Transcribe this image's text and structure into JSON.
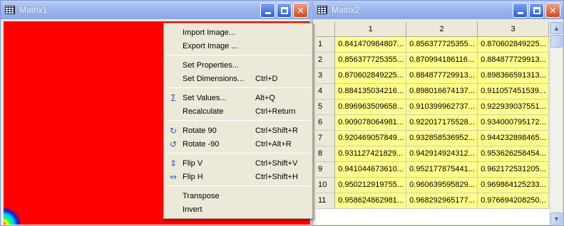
{
  "matrix1": {
    "title": "Matrix1"
  },
  "matrix2": {
    "title": "Matrix2",
    "columns": [
      "1",
      "2",
      "3"
    ],
    "rows": [
      {
        "label": "1",
        "cells": [
          "0.841470984807...",
          "0.856377725355...",
          "0.870602849225..."
        ]
      },
      {
        "label": "2",
        "cells": [
          "0.856377725355...",
          "0.870994186116...",
          "0.884877729913..."
        ]
      },
      {
        "label": "3",
        "cells": [
          "0.870602849225...",
          "0.884877729913...",
          "0.898366591313..."
        ]
      },
      {
        "label": "4",
        "cells": [
          "0.884135034216...",
          "0.898016674137...",
          "0.911057451539..."
        ]
      },
      {
        "label": "5",
        "cells": [
          "0.896963509658...",
          "0.910399962737...",
          "0.922939037551..."
        ]
      },
      {
        "label": "6",
        "cells": [
          "0.909078064981...",
          "0.922017175528...",
          "0.934000795172..."
        ]
      },
      {
        "label": "7",
        "cells": [
          "0.920469057849...",
          "0.932858536952...",
          "0.944232898465..."
        ]
      },
      {
        "label": "8",
        "cells": [
          "0.931127421829...",
          "0.942914924312...",
          "0.953626258454..."
        ]
      },
      {
        "label": "9",
        "cells": [
          "0.941044673610...",
          "0.952177875441...",
          "0.962172531205..."
        ]
      },
      {
        "label": "10",
        "cells": [
          "0.950212919755...",
          "0.960639595829...",
          "0.969864125233..."
        ]
      },
      {
        "label": "11",
        "cells": [
          "0.958624862981...",
          "0.968292965177...",
          "0.976694208250..."
        ]
      }
    ]
  },
  "menu": {
    "items": [
      {
        "label": "Import Image...",
        "shortcut": "",
        "icon": ""
      },
      {
        "label": "Export Image ...",
        "shortcut": "",
        "icon": ""
      },
      {
        "sep": true
      },
      {
        "label": "Set Properties...",
        "shortcut": "",
        "icon": ""
      },
      {
        "label": "Set Dimensions...",
        "shortcut": "Ctrl+D",
        "icon": ""
      },
      {
        "sep": true
      },
      {
        "label": "Set Values...",
        "shortcut": "Alt+Q",
        "icon": "sigma-icon"
      },
      {
        "label": "Recalculate",
        "shortcut": "Ctrl+Return",
        "icon": ""
      },
      {
        "sep": true
      },
      {
        "label": "Rotate 90",
        "shortcut": "Ctrl+Shift+R",
        "icon": "rotate-cw-icon"
      },
      {
        "label": "Rotate -90",
        "shortcut": "Ctrl+Alt+R",
        "icon": "rotate-ccw-icon"
      },
      {
        "sep": true
      },
      {
        "label": "Flip V",
        "shortcut": "Ctrl+Shift+V",
        "icon": "flip-vertical-icon"
      },
      {
        "label": "Flip H",
        "shortcut": "Ctrl+Shift+H",
        "icon": "flip-horizontal-icon"
      },
      {
        "sep": true
      },
      {
        "label": "Transpose",
        "shortcut": "",
        "icon": ""
      },
      {
        "label": "Invert",
        "shortcut": "",
        "icon": ""
      }
    ]
  },
  "colors": {
    "cell_bg": "#ffff8a",
    "titlebar_active": "#2a5bd6",
    "titlebar_inactive": "#9fb8ec"
  }
}
